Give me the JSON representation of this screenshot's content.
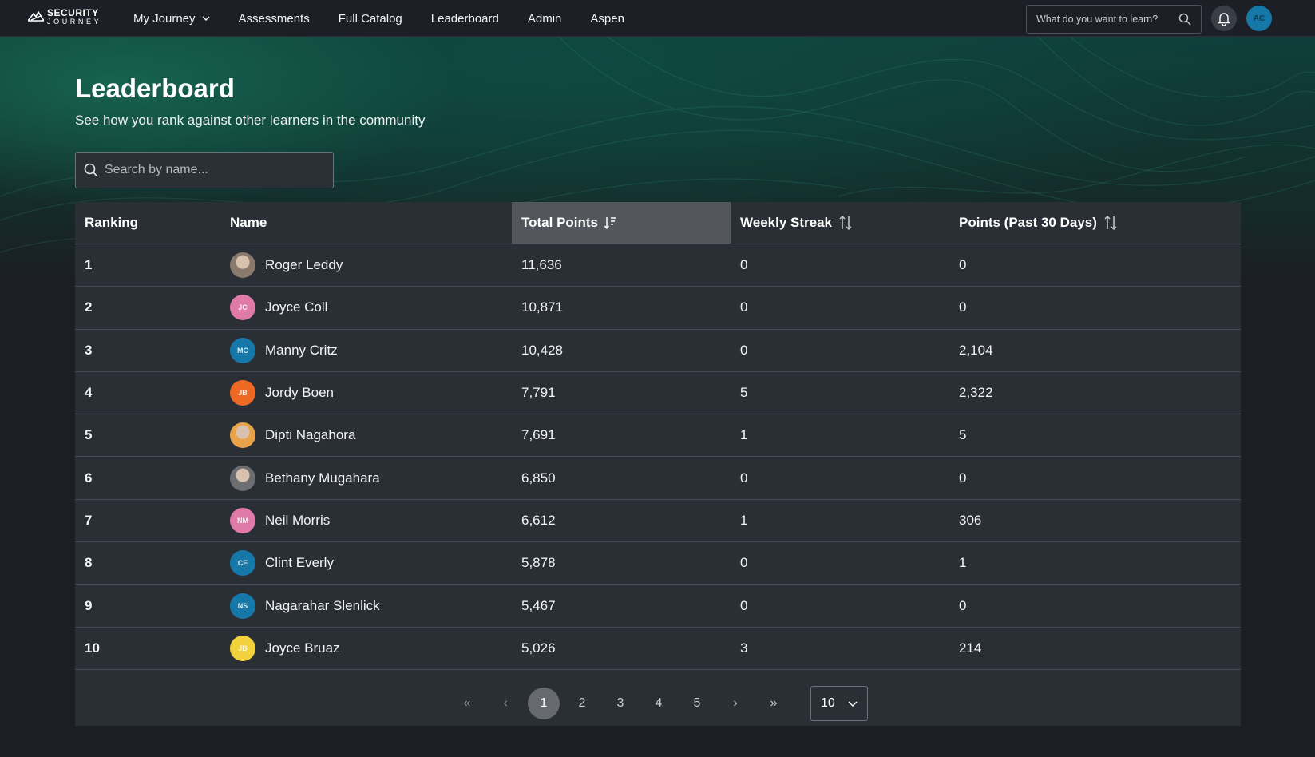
{
  "nav": {
    "logo_top": "SECURITY",
    "logo_bottom": "JOURNEY",
    "items": [
      {
        "label": "My Journey",
        "has_dropdown": true
      },
      {
        "label": "Assessments"
      },
      {
        "label": "Full Catalog"
      },
      {
        "label": "Leaderboard"
      },
      {
        "label": "Admin"
      },
      {
        "label": "Aspen"
      }
    ],
    "search_placeholder": "What do you want to learn?",
    "user_initials": "AC"
  },
  "page": {
    "title": "Leaderboard",
    "subtitle": "See how you rank against other learners in the community",
    "search_placeholder": "Search by name..."
  },
  "table": {
    "headers": {
      "ranking": "Ranking",
      "name": "Name",
      "total_points": "Total Points",
      "weekly_streak": "Weekly Streak",
      "points_30": "Points (Past 30 Days)"
    },
    "sorted_by": "total_points",
    "rows": [
      {
        "rank": "1",
        "name": "Roger Leddy",
        "initials": "",
        "avatar_color": "#8a7a6e",
        "total": "11,636",
        "weekly": "0",
        "p30": "0"
      },
      {
        "rank": "2",
        "name": "Joyce Coll",
        "initials": "JC",
        "avatar_color": "#e07aa8",
        "total": "10,871",
        "weekly": "0",
        "p30": "0"
      },
      {
        "rank": "3",
        "name": "Manny Critz",
        "initials": "MC",
        "avatar_color": "#1578a8",
        "total": "10,428",
        "weekly": "0",
        "p30": "2,104"
      },
      {
        "rank": "4",
        "name": "Jordy Boen",
        "initials": "JB",
        "avatar_color": "#ee6a24",
        "total": "7,791",
        "weekly": "5",
        "p30": "2,322"
      },
      {
        "rank": "5",
        "name": "Dipti Nagahora",
        "initials": "",
        "avatar_color": "#e8a24a",
        "total": "7,691",
        "weekly": "1",
        "p30": "5"
      },
      {
        "rank": "6",
        "name": "Bethany Mugahara",
        "initials": "",
        "avatar_color": "#6c6e72",
        "total": "6,850",
        "weekly": "0",
        "p30": "0"
      },
      {
        "rank": "7",
        "name": "Neil Morris",
        "initials": "NM",
        "avatar_color": "#e07aa8",
        "total": "6,612",
        "weekly": "1",
        "p30": "306"
      },
      {
        "rank": "8",
        "name": "Clint Everly",
        "initials": "CE",
        "avatar_color": "#1578a8",
        "total": "5,878",
        "weekly": "0",
        "p30": "1"
      },
      {
        "rank": "9",
        "name": "Nagarahar Slenlick",
        "initials": "NS",
        "avatar_color": "#1578a8",
        "total": "5,467",
        "weekly": "0",
        "p30": "0"
      },
      {
        "rank": "10",
        "name": "Joyce Bruaz",
        "initials": "JB",
        "avatar_color": "#f2d23c",
        "total": "5,026",
        "weekly": "3",
        "p30": "214"
      }
    ]
  },
  "pagination": {
    "first": "«",
    "prev": "‹",
    "pages": [
      "1",
      "2",
      "3",
      "4",
      "5"
    ],
    "current": "1",
    "next": "›",
    "last": "»",
    "per_page": "10"
  }
}
